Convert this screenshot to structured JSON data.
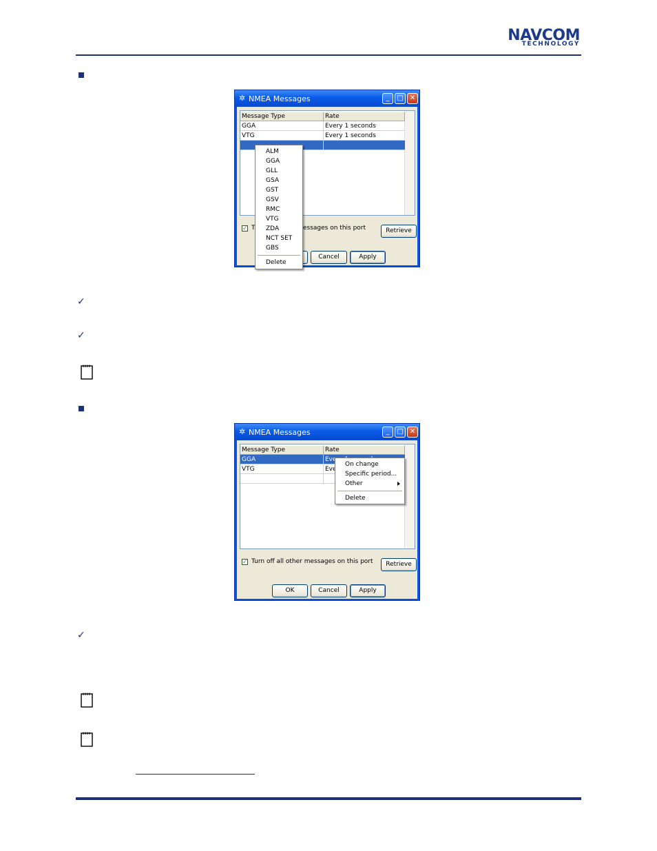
{
  "header": {
    "logo_main": "NAVCOM",
    "logo_sub": "TECHNOLOGY"
  },
  "dialog1": {
    "title": "NMEA Messages",
    "columns": [
      "Message Type",
      "Rate"
    ],
    "rows": [
      {
        "type": "GGA",
        "rate": "Every 1 seconds"
      },
      {
        "type": "VTG",
        "rate": "Every 1 seconds"
      },
      {
        "type": "",
        "rate": ""
      }
    ],
    "checkbox_prefix": "T",
    "checkbox_suffix": "essages on this port",
    "retrieve_label": "Retrieve",
    "cancel_label": "Cancel",
    "apply_label": "Apply",
    "menu": {
      "items": [
        "ALM",
        "GGA",
        "GLL",
        "GSA",
        "GST",
        "GSV",
        "RMC",
        "VTG",
        "ZDA",
        "NCT SET",
        "GBS"
      ],
      "delete_label": "Delete"
    }
  },
  "dialog2": {
    "title": "NMEA Messages",
    "columns": [
      "Message Type",
      "Rate"
    ],
    "rows": [
      {
        "type": "GGA",
        "rate": "Every 1 seconds"
      },
      {
        "type": "VTG",
        "rate": "Eve"
      },
      {
        "type": "",
        "rate": ""
      }
    ],
    "checkbox_label": "Turn off all other messages on this port",
    "retrieve_label": "Retrieve",
    "ok_label": "OK",
    "cancel_label": "Cancel",
    "apply_label": "Apply",
    "menu": {
      "items": [
        "On change",
        "Specific period...",
        "Other"
      ],
      "delete_label": "Delete"
    }
  },
  "icons": {
    "bullet": "square-bullet-icon",
    "check": "checkmark-icon",
    "note": "notepad-icon"
  },
  "colors": {
    "brand_blue": "#1b2f7d",
    "xp_title_blue": "#0a54e3",
    "selection_blue": "#316ac5"
  }
}
